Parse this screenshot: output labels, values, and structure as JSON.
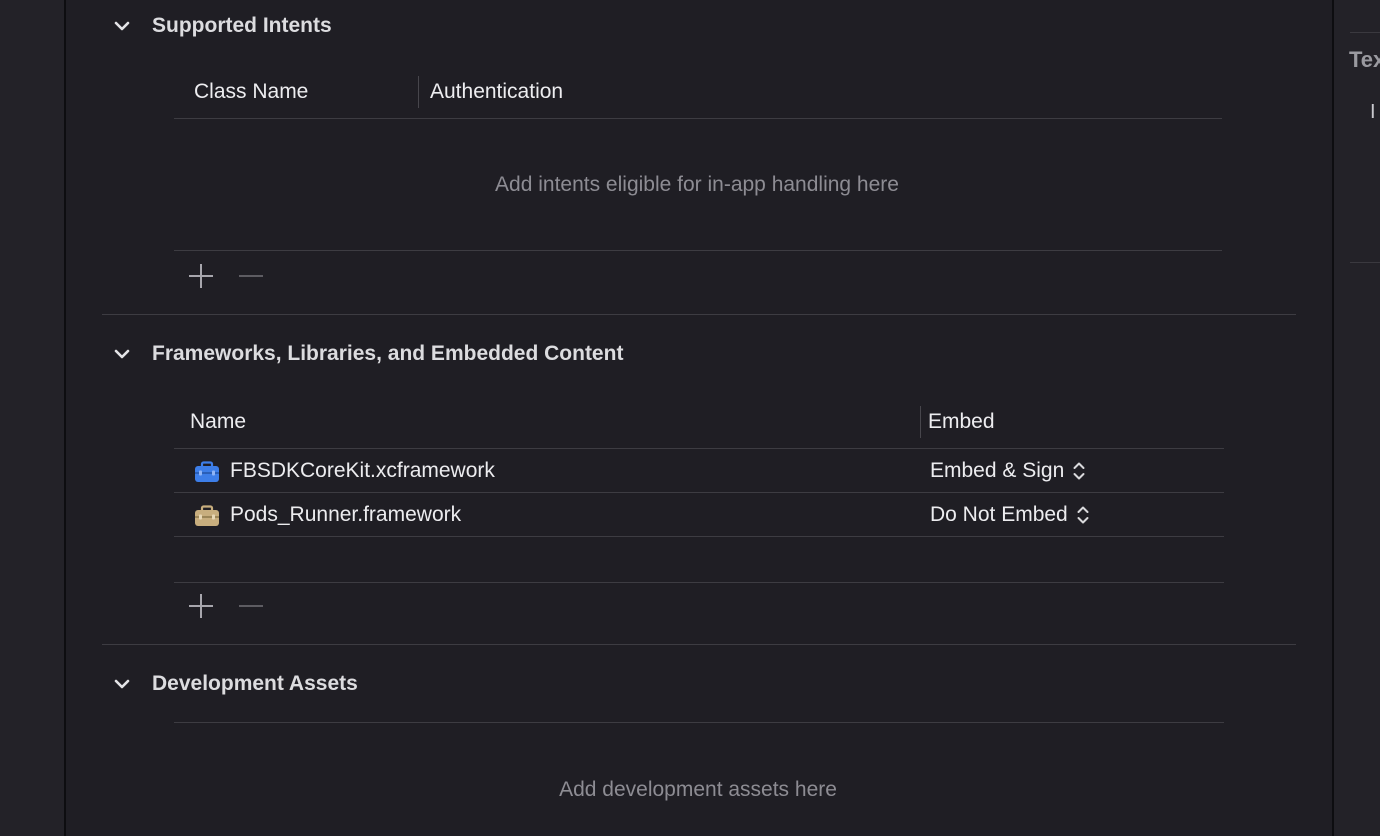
{
  "inspector": {
    "heading": "Tex",
    "sub": "I"
  },
  "sections": {
    "supported_intents": {
      "title": "Supported Intents",
      "columns": [
        "Class Name",
        "Authentication"
      ],
      "placeholder": "Add intents eligible for in-app handling here",
      "add_icon": "plus-icon",
      "remove_icon": "minus-icon"
    },
    "frameworks": {
      "title": "Frameworks, Libraries, and Embedded Content",
      "columns": [
        "Name",
        "Embed"
      ],
      "rows": [
        {
          "name": "FBSDKCoreKit.xcframework",
          "embed": "Embed & Sign",
          "icon": "framework-toolbox-blue-icon",
          "icon_color": "#3d7ee8"
        },
        {
          "name": "Pods_Runner.framework",
          "embed": "Do Not Embed",
          "icon": "framework-toolbox-tan-icon",
          "icon_color": "#c8ae7e"
        }
      ],
      "add_icon": "plus-icon",
      "remove_icon": "minus-icon"
    },
    "development_assets": {
      "title": "Development Assets",
      "placeholder": "Add development assets here"
    }
  },
  "colors": {
    "background": "#1f1e24",
    "text": "#e6e6e9",
    "placeholder": "#8d8c93",
    "divider": "#3d3c42"
  }
}
